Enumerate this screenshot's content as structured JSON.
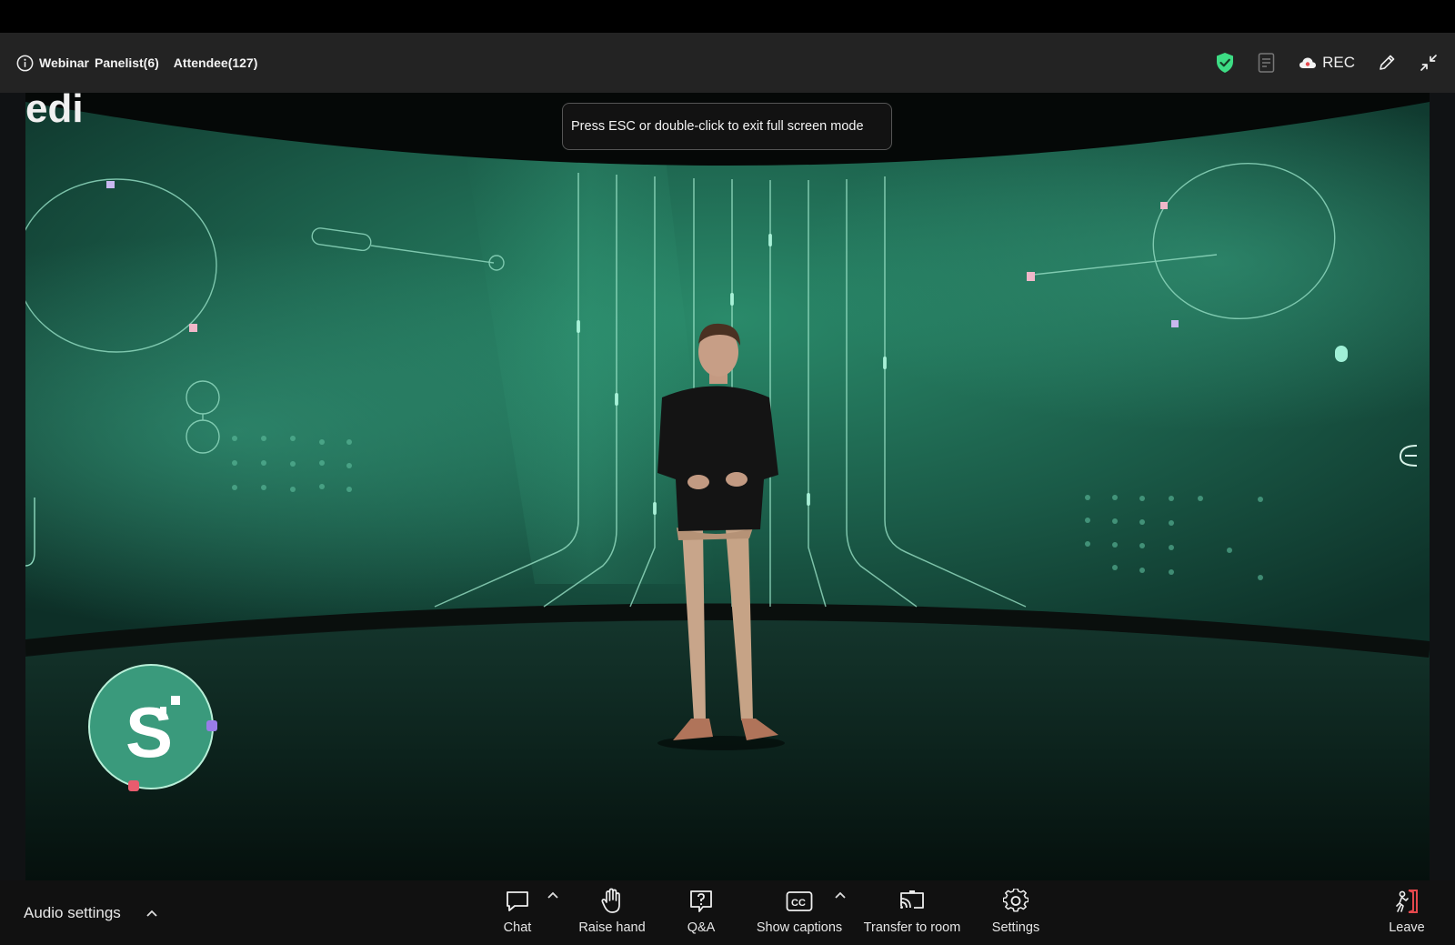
{
  "header": {
    "meeting_type": "Webinar",
    "panelists": "Panelist(6)",
    "attendees": "Attendee(127)",
    "rec_label": "REC"
  },
  "notification": {
    "text": "Press ESC or double-click to exit full screen mode"
  },
  "toolbar": {
    "audio_label": "Audio settings",
    "chat_label": "Chat",
    "raise_hand_label": "Raise hand",
    "qa_label": "Q&A",
    "captions_label": "Show captions",
    "transfer_label": "Transfer to room",
    "settings_label": "Settings",
    "leave_label": "Leave"
  },
  "video": {
    "logo_letter": "S",
    "corner_text": "edi"
  },
  "colors": {
    "header_bg": "#232323",
    "toolbar_bg": "#111111",
    "security_green": "#3ddc84",
    "leave_red": "#e5484d",
    "stage_teal": "#1f6b55"
  }
}
